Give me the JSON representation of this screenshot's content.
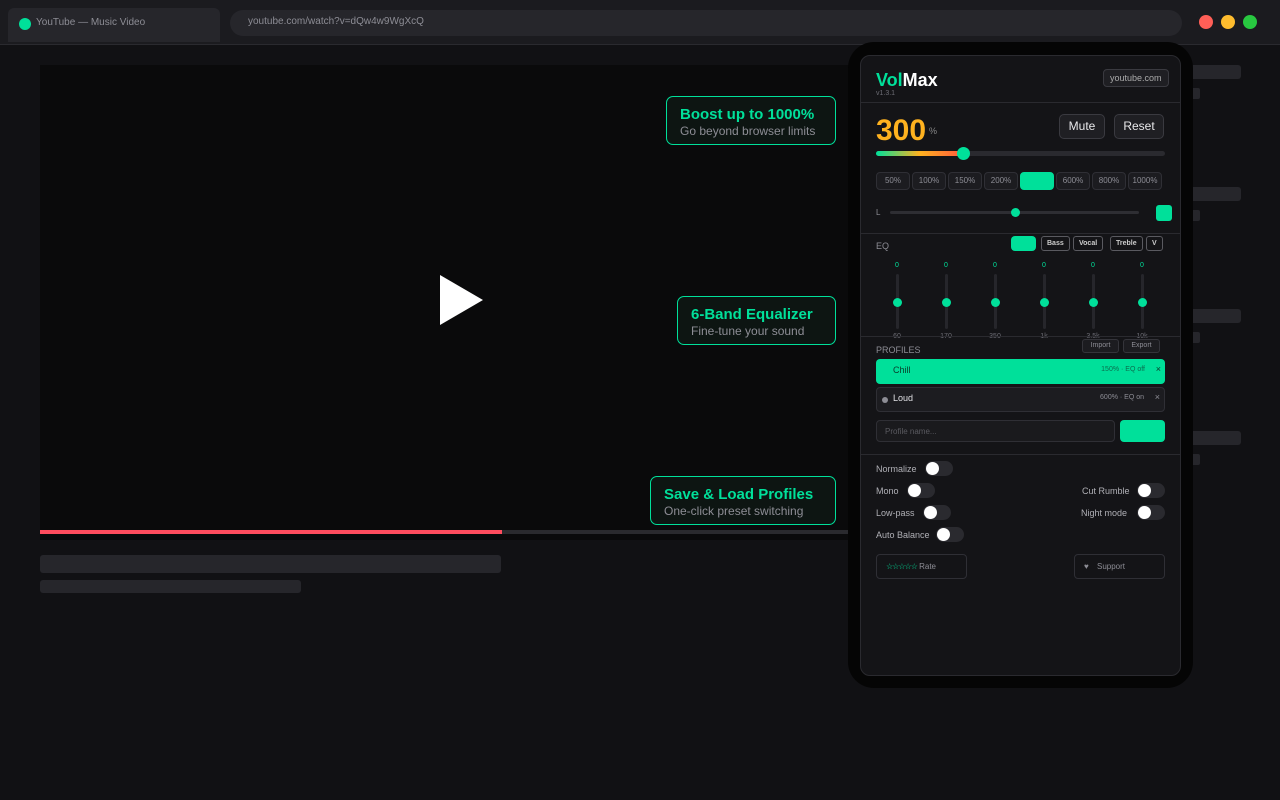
{
  "browser": {
    "tab_title": "YouTube — Music Video",
    "url": "youtube.com/watch?v=dQw4w9WgXcQ"
  },
  "video": {
    "progress": 0.57
  },
  "callouts": [
    {
      "title": "Boost up to 1000%",
      "subtitle": "Go beyond browser limits"
    },
    {
      "title": "6-Band Equalizer",
      "subtitle": "Fine-tune your sound"
    },
    {
      "title": "Save & Load Profiles",
      "subtitle": "One-click preset switching"
    }
  ],
  "extension": {
    "brand_vol": "Vol",
    "brand_max": "Max",
    "version": "v1.3.1",
    "site": "youtube.com",
    "volume_value": "300",
    "volume_unit": "%",
    "volume_fraction": 0.3,
    "mute_label": "Mute",
    "reset_label": "Reset",
    "presets": [
      "50%",
      "100%",
      "150%",
      "200%",
      "",
      "600%",
      "800%",
      "1000%"
    ],
    "active_preset_index": 4,
    "balance_left_label": "L",
    "balance": 0.5,
    "eq": {
      "label": "EQ",
      "chips": [
        "Bass",
        "Vocal",
        "Treble",
        "V"
      ],
      "bands": [
        {
          "value": "0",
          "freq": "60"
        },
        {
          "value": "0",
          "freq": "170"
        },
        {
          "value": "0",
          "freq": "350"
        },
        {
          "value": "0",
          "freq": "1k"
        },
        {
          "value": "0",
          "freq": "3.5k"
        },
        {
          "value": "0",
          "freq": "10k"
        }
      ]
    },
    "profiles": {
      "label": "PROFILES",
      "import_label": "Import",
      "export_label": "Export",
      "items": [
        {
          "name": "Chill",
          "meta": "150% · EQ off",
          "remove": "×"
        },
        {
          "name": "Loud",
          "meta": "600% · EQ on",
          "remove": "×"
        }
      ],
      "name_placeholder": "Profile name..."
    },
    "options": {
      "normalize": "Normalize",
      "mono": "Mono",
      "cut_rumble": "Cut Rumble",
      "low_pass": "Low-pass",
      "night_mode": "Night mode",
      "auto_balance": "Auto Balance"
    },
    "footer": {
      "rate_stars": "☆☆☆☆☆",
      "rate_label": "Rate",
      "support_icon": "♥",
      "support_label": "Support"
    }
  },
  "colors": {
    "accent": "#00e09a",
    "volume_number": "#ffb21f",
    "progress": "#ff4d5e"
  }
}
